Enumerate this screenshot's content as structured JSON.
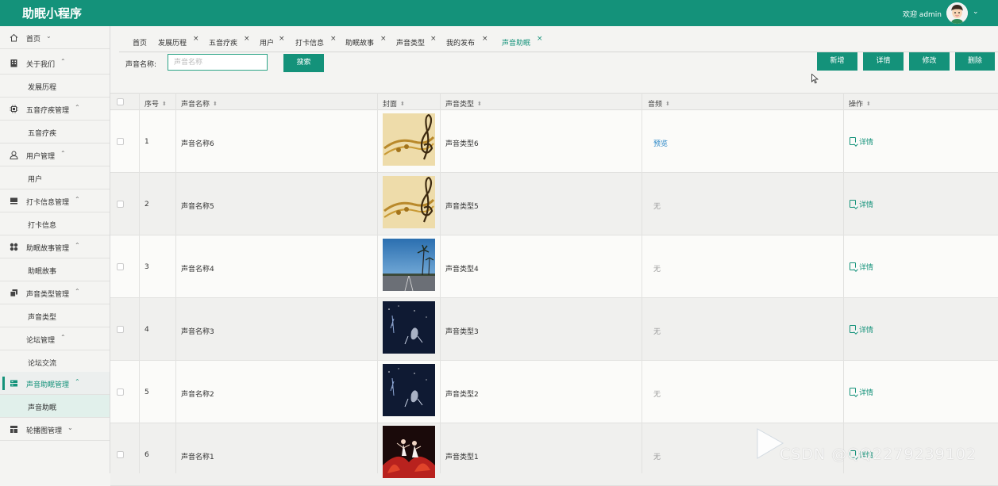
{
  "header": {
    "title": "助眠小程序",
    "welcome": "欢迎 admin"
  },
  "sidebar": {
    "items": [
      {
        "label": "首页",
        "icon": "home-icon",
        "type": "parent"
      },
      {
        "label": "关于我们",
        "icon": "building-icon",
        "type": "parent"
      },
      {
        "label": "发展历程",
        "type": "sub"
      },
      {
        "label": "五音疗疾管理",
        "icon": "chip-icon",
        "type": "parent"
      },
      {
        "label": "五音疗疾",
        "type": "sub"
      },
      {
        "label": "用户管理",
        "icon": "user-icon",
        "type": "parent"
      },
      {
        "label": "用户",
        "type": "sub"
      },
      {
        "label": "打卡信息管理",
        "icon": "card-icon",
        "type": "parent"
      },
      {
        "label": "打卡信息",
        "type": "sub"
      },
      {
        "label": "助眠故事管理",
        "icon": "grid-icon",
        "type": "parent"
      },
      {
        "label": "助眠故事",
        "type": "sub"
      },
      {
        "label": "声音类型管理",
        "icon": "copy-icon",
        "type": "parent"
      },
      {
        "label": "声音类型",
        "type": "sub"
      },
      {
        "label": "论坛管理",
        "type": "sub-parent"
      },
      {
        "label": "论坛交流",
        "type": "sub"
      },
      {
        "label": "声音助眠管理",
        "icon": "server-icon",
        "type": "parent",
        "active": true
      },
      {
        "label": "声音助眠",
        "type": "sub",
        "active": true
      },
      {
        "label": "轮播图管理",
        "icon": "layout-icon",
        "type": "parent"
      }
    ]
  },
  "tabs": [
    {
      "label": "首页",
      "closable": false
    },
    {
      "label": "发展历程",
      "closable": true
    },
    {
      "label": "五音疗疾",
      "closable": true
    },
    {
      "label": "用户",
      "closable": true
    },
    {
      "label": "打卡信息",
      "closable": true
    },
    {
      "label": "助眠故事",
      "closable": true
    },
    {
      "label": "声音类型",
      "closable": true
    },
    {
      "label": "我的发布",
      "closable": true
    },
    {
      "label": "声音助眠",
      "closable": true,
      "active": true
    }
  ],
  "search": {
    "label": "声音名称:",
    "placeholder": "声音名称",
    "value": "",
    "button": "搜索"
  },
  "actions": {
    "add": "新增",
    "detail": "详情",
    "edit": "修改",
    "delete": "删除"
  },
  "table": {
    "columns": [
      "序号",
      "声音名称",
      "封面",
      "声音类型",
      "音频",
      "操作"
    ],
    "rows": [
      {
        "no": "1",
        "name": "声音名称6",
        "cover": "music-score",
        "type": "声音类型6",
        "audio": "预览",
        "audio_link": true,
        "op": "详情"
      },
      {
        "no": "2",
        "name": "声音名称5",
        "cover": "music-score",
        "type": "声音类型5",
        "audio": "无",
        "audio_link": false,
        "op": "详情"
      },
      {
        "no": "3",
        "name": "声音名称4",
        "cover": "palm-road",
        "type": "声音类型4",
        "audio": "无",
        "audio_link": false,
        "op": "详情"
      },
      {
        "no": "4",
        "name": "声音名称3",
        "cover": "night-sky",
        "type": "声音类型3",
        "audio": "无",
        "audio_link": false,
        "op": "详情"
      },
      {
        "no": "5",
        "name": "声音名称2",
        "cover": "night-sky",
        "type": "声音类型2",
        "audio": "无",
        "audio_link": false,
        "op": "详情"
      },
      {
        "no": "6",
        "name": "声音名称1",
        "cover": "dancers",
        "type": "声音类型1",
        "audio": "无",
        "audio_link": false,
        "op": "详情"
      }
    ]
  },
  "watermark": "CSDN @QQ2279239102",
  "colors": {
    "primary": "#14927a",
    "link": "#2b87c7",
    "background": "#f4f4f2"
  }
}
